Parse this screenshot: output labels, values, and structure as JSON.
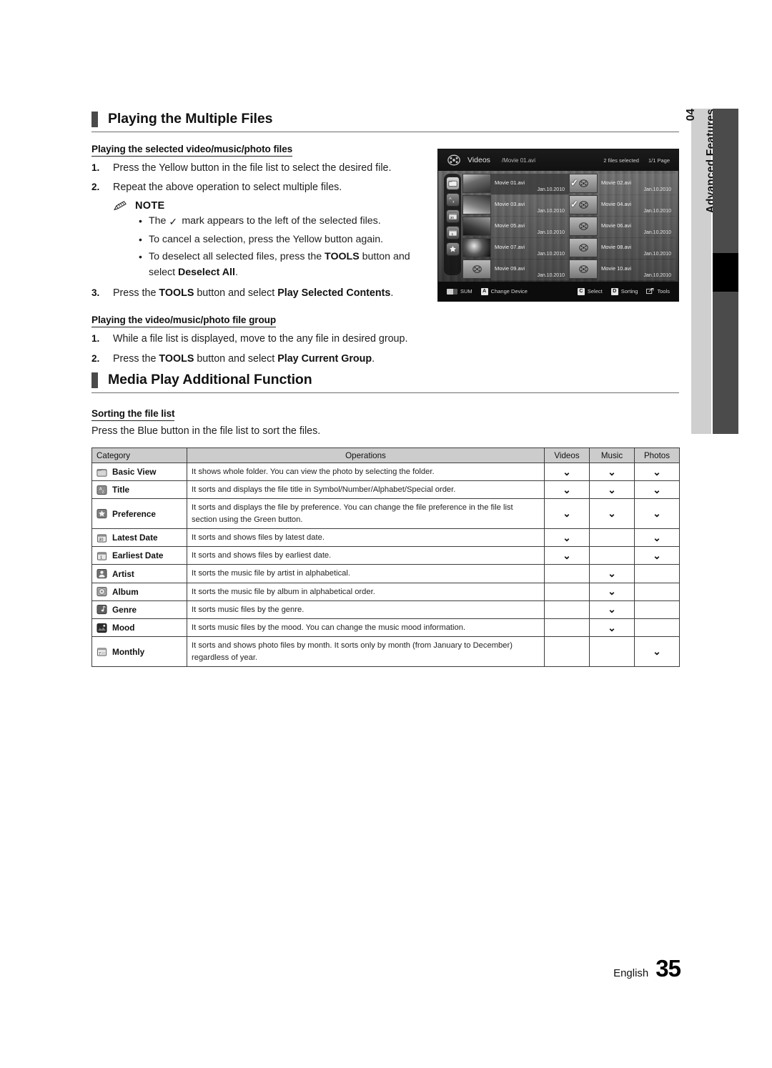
{
  "chapter_tab": {
    "number": "04",
    "label": "Advanced Features"
  },
  "sections": [
    {
      "title": "Playing the Multiple Files",
      "subsections": [
        {
          "heading": "Playing the selected video/music/photo files",
          "steps": [
            {
              "num": "1.",
              "text": "Press the Yellow button in the file list to select the desired file."
            },
            {
              "num": "2.",
              "text": "Repeat the above operation to select multiple files."
            }
          ],
          "note": {
            "title": "NOTE",
            "bullets": [
              {
                "pre": "The ",
                "tick": "✓",
                "post": " mark appears to the left of the selected files."
              },
              {
                "pre": "To cancel a selection, press the Yellow button again.",
                "tick": "",
                "post": ""
              },
              {
                "pre": "To deselect all selected files, press the ",
                "bold1": "TOOLS",
                "mid": " button and select ",
                "bold2": "Deselect All",
                "post2": "."
              }
            ]
          },
          "steps_after": [
            {
              "num": "3.",
              "pre": "Press the ",
              "bold1": "TOOLS",
              "mid": " button and select ",
              "bold2": "Play Selected Contents",
              "post": "."
            }
          ]
        },
        {
          "heading": "Playing the video/music/photo file group",
          "steps": [
            {
              "num": "1.",
              "text": "While a file list is displayed, move to the any file in desired group."
            }
          ],
          "steps_bold": [
            {
              "num": "2.",
              "pre": "Press the ",
              "bold1": "TOOLS",
              "mid": " button and select ",
              "bold2": "Play Current Group",
              "post": "."
            }
          ]
        }
      ]
    },
    {
      "title": "Media Play Additional Function",
      "subsections": [
        {
          "heading": "Sorting the file list",
          "intro": "Press the Blue button in the file list to sort the files."
        }
      ]
    }
  ],
  "tv_screenshot": {
    "category": "Videos",
    "path": "/Movie 01.avi",
    "selected_count": "2 files selected",
    "page": "1/1 Page",
    "rail_icons": [
      "folder-icon",
      "az-sort-icon",
      "calendar-30-icon",
      "calendar-1-icon",
      "star-icon"
    ],
    "files": [
      {
        "name": "Movie 01.avi",
        "date": "Jan.10.2010",
        "checked": false,
        "highlight": true,
        "thumb": "photo"
      },
      {
        "name": "Movie 02.avi",
        "date": "Jan.10.2010",
        "checked": true,
        "highlight": false,
        "thumb": "film"
      },
      {
        "name": "Movie 03.avi",
        "date": "Jan.10.2010",
        "checked": false,
        "highlight": false,
        "thumb": "photo"
      },
      {
        "name": "Movie 04.avi",
        "date": "Jan.10.2010",
        "checked": true,
        "highlight": false,
        "thumb": "film"
      },
      {
        "name": "Movie 05.avi",
        "date": "Jan.10.2010",
        "checked": false,
        "highlight": false,
        "thumb": "photo"
      },
      {
        "name": "Movie 06.avi",
        "date": "Jan.10.2010",
        "checked": false,
        "highlight": false,
        "thumb": "film"
      },
      {
        "name": "Movie 07.avi",
        "date": "Jan.10.2010",
        "checked": false,
        "highlight": false,
        "thumb": "photo"
      },
      {
        "name": "Movie 08.avi",
        "date": "Jan.10.2010",
        "checked": false,
        "highlight": false,
        "thumb": "film"
      },
      {
        "name": "Movie 09.avi",
        "date": "Jan.10.2010",
        "checked": false,
        "highlight": false,
        "thumb": "film"
      },
      {
        "name": "Movie 10.avi",
        "date": "Jan.10.2010",
        "checked": false,
        "highlight": false,
        "thumb": "film"
      }
    ],
    "bottom_left": [
      {
        "key": "",
        "icon": "usb-icon",
        "label": "SUM"
      },
      {
        "key": "A",
        "icon": "",
        "label": "Change Device"
      }
    ],
    "bottom_right": [
      {
        "key": "C",
        "icon": "",
        "label": "Select"
      },
      {
        "key": "D",
        "icon": "",
        "label": "Sorting"
      },
      {
        "key": "",
        "icon": "tools-icon",
        "label": "Tools"
      }
    ]
  },
  "table": {
    "headers": {
      "category": "Category",
      "operations": "Operations",
      "videos": "Videos",
      "music": "Music",
      "photos": "Photos"
    },
    "rows": [
      {
        "icon": "folder-icon",
        "category": "Basic View",
        "operations": "It shows whole folder. You can view the photo by selecting the folder.",
        "videos": "⌄",
        "music": "⌄",
        "photos": "⌄"
      },
      {
        "icon": "az-sort-icon",
        "category": "Title",
        "operations": "It sorts and displays the file title in Symbol/Number/Alphabet/Special order.",
        "videos": "⌄",
        "music": "⌄",
        "photos": "⌄"
      },
      {
        "icon": "star-icon",
        "category": "Preference",
        "operations": "It sorts and displays the file by preference. You can change the file preference in the file list section using the Green button.",
        "videos": "⌄",
        "music": "⌄",
        "photos": "⌄"
      },
      {
        "icon": "calendar-30-icon",
        "category": "Latest Date",
        "operations": "It sorts and shows files by latest date.",
        "videos": "⌄",
        "music": "",
        "photos": "⌄"
      },
      {
        "icon": "calendar-1-icon",
        "category": "Earliest Date",
        "operations": "It sorts and shows files by earliest date.",
        "videos": "⌄",
        "music": "",
        "photos": "⌄"
      },
      {
        "icon": "artist-icon",
        "category": "Artist",
        "operations": "It sorts the music file by artist in alphabetical.",
        "videos": "",
        "music": "⌄",
        "photos": ""
      },
      {
        "icon": "album-icon",
        "category": "Album",
        "operations": "It sorts the music file by album in alphabetical order.",
        "videos": "",
        "music": "⌄",
        "photos": ""
      },
      {
        "icon": "genre-icon",
        "category": "Genre",
        "operations": "It sorts music files by the genre.",
        "videos": "",
        "music": "⌄",
        "photos": ""
      },
      {
        "icon": "mood-icon",
        "category": "Mood",
        "operations": "It sorts music files by the mood. You can change the music mood information.",
        "videos": "",
        "music": "⌄",
        "photos": ""
      },
      {
        "icon": "calendar-7-icon",
        "category": "Monthly",
        "operations": "It sorts and shows photo files by month. It sorts only by month (from January to December) regardless of year.",
        "videos": "",
        "music": "",
        "photos": "⌄"
      }
    ]
  },
  "footer": {
    "language": "English",
    "page_number": "35"
  }
}
